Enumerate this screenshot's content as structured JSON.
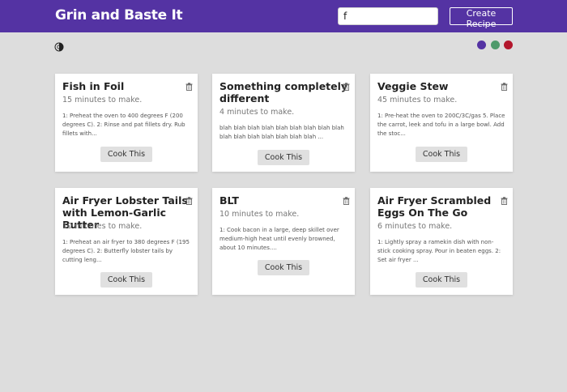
{
  "header": {
    "title": "Grin and Baste It",
    "search_value": "f",
    "create_label": "Create Recipe"
  },
  "toolbar": {
    "theme_icon": "brightness-icon",
    "swatches": [
      {
        "color": "#5433a3"
      },
      {
        "color": "#4e9a6b"
      },
      {
        "color": "#b3162c"
      }
    ]
  },
  "recipes": [
    {
      "title": "Fish in Foil",
      "time": "15 minutes to make.",
      "desc": "1: Preheat the oven to 400 degrees F (200 degrees C). 2: Rinse and pat fillets dry. Rub fillets with...",
      "button": "Cook This"
    },
    {
      "title": "Something completely different",
      "time": "4 minutes to make.",
      "desc": "blah blah blah blah blah blah blah blah blah blah blah blah blah blah blah blah ...",
      "button": "Cook This"
    },
    {
      "title": "Veggie Stew",
      "time": "45 minutes to make.",
      "desc": "1: Pre-heat the oven to 200C/3C/gas 5. Place the carrot, leek and tofu in a large bowl. Add the stoc...",
      "button": "Cook This"
    },
    {
      "title": "Air Fryer Lobster Tails with Lemon-Garlic Butter",
      "time": "10 minutes to make.",
      "desc": "1: Preheat an air fryer to 380 degrees F (195 degrees C). 2: Butterfly lobster tails by cutting leng...",
      "button": "Cook This"
    },
    {
      "title": "BLT",
      "time": "10 minutes to make.",
      "desc": "1: Cook bacon in a large, deep skillet over medium-high heat until evenly browned, about 10 minutes....",
      "button": "Cook This"
    },
    {
      "title": "Air Fryer Scrambled Eggs On The Go",
      "time": "6 minutes to make.",
      "desc": "1: Lightly spray a ramekin dish with non-stick cooking spray. Pour in beaten eggs. 2: Set air fryer ...",
      "button": "Cook This"
    }
  ]
}
